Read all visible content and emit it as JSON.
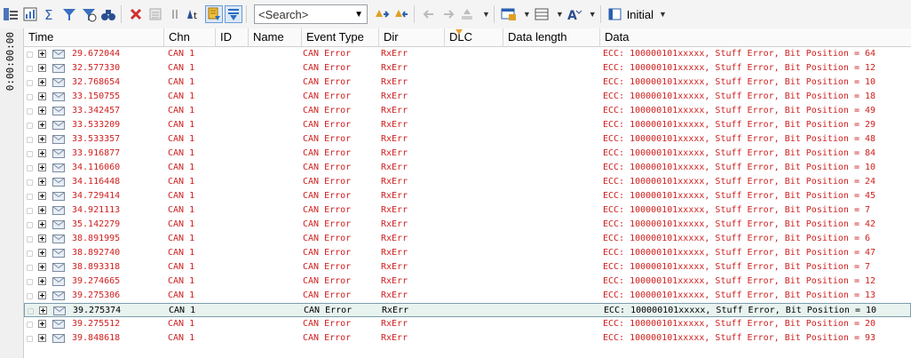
{
  "toolbar": {
    "search_placeholder": "<Search>",
    "layout_label": "Initial",
    "buttons": [
      "trace-config-icon",
      "statistics-icon",
      "filter-sigma-icon",
      "filter-funnel-icon",
      "filter-funnel-remove-icon",
      "find-binoculars-icon",
      "delete-x-icon",
      "clear-icon",
      "pause-icon",
      "auto-time-icon",
      "scroll-lock-icon",
      "chronological-icon",
      "find-next-icon",
      "find-prev-icon",
      "back-arrow-icon",
      "forward-arrow-icon",
      "marker-icon",
      "window-layout-icon",
      "columns-icon",
      "font-color-icon",
      "display-mode-icon"
    ]
  },
  "side": {
    "time_marker": "0:00:00:00"
  },
  "columns": [
    "Time",
    "Chn",
    "ID",
    "Name",
    "Event Type",
    "Dir",
    "DLC",
    "Data length",
    "Data"
  ],
  "rows": [
    {
      "time": "29.672044",
      "chn": "CAN 1",
      "event": "CAN Error",
      "dir": "RxErr",
      "data": "ECC: 100000101xxxxx, Stuff Error, Bit Position = 64"
    },
    {
      "time": "32.577330",
      "chn": "CAN 1",
      "event": "CAN Error",
      "dir": "RxErr",
      "data": "ECC: 100000101xxxxx, Stuff Error, Bit Position = 12"
    },
    {
      "time": "32.768654",
      "chn": "CAN 1",
      "event": "CAN Error",
      "dir": "RxErr",
      "data": "ECC: 100000101xxxxx, Stuff Error, Bit Position = 10"
    },
    {
      "time": "33.150755",
      "chn": "CAN 1",
      "event": "CAN Error",
      "dir": "RxErr",
      "data": "ECC: 100000101xxxxx, Stuff Error, Bit Position = 18"
    },
    {
      "time": "33.342457",
      "chn": "CAN 1",
      "event": "CAN Error",
      "dir": "RxErr",
      "data": "ECC: 100000101xxxxx, Stuff Error, Bit Position = 49"
    },
    {
      "time": "33.533209",
      "chn": "CAN 1",
      "event": "CAN Error",
      "dir": "RxErr",
      "data": "ECC: 100000101xxxxx, Stuff Error, Bit Position = 29"
    },
    {
      "time": "33.533357",
      "chn": "CAN 1",
      "event": "CAN Error",
      "dir": "RxErr",
      "data": "ECC: 100000101xxxxx, Stuff Error, Bit Position = 48"
    },
    {
      "time": "33.916877",
      "chn": "CAN 1",
      "event": "CAN Error",
      "dir": "RxErr",
      "data": "ECC: 100000101xxxxx, Stuff Error, Bit Position = 84"
    },
    {
      "time": "34.116060",
      "chn": "CAN 1",
      "event": "CAN Error",
      "dir": "RxErr",
      "data": "ECC: 100000101xxxxx, Stuff Error, Bit Position = 10"
    },
    {
      "time": "34.116448",
      "chn": "CAN 1",
      "event": "CAN Error",
      "dir": "RxErr",
      "data": "ECC: 100000101xxxxx, Stuff Error, Bit Position = 24"
    },
    {
      "time": "34.729414",
      "chn": "CAN 1",
      "event": "CAN Error",
      "dir": "RxErr",
      "data": "ECC: 100000101xxxxx, Stuff Error, Bit Position = 45"
    },
    {
      "time": "34.921113",
      "chn": "CAN 1",
      "event": "CAN Error",
      "dir": "RxErr",
      "data": "ECC: 100000101xxxxx, Stuff Error, Bit Position = 7"
    },
    {
      "time": "35.142279",
      "chn": "CAN 1",
      "event": "CAN Error",
      "dir": "RxErr",
      "data": "ECC: 100000101xxxxx, Stuff Error, Bit Position = 42"
    },
    {
      "time": "38.891995",
      "chn": "CAN 1",
      "event": "CAN Error",
      "dir": "RxErr",
      "data": "ECC: 100000101xxxxx, Stuff Error, Bit Position = 6"
    },
    {
      "time": "38.892740",
      "chn": "CAN 1",
      "event": "CAN Error",
      "dir": "RxErr",
      "data": "ECC: 100000101xxxxx, Stuff Error, Bit Position = 47"
    },
    {
      "time": "38.893318",
      "chn": "CAN 1",
      "event": "CAN Error",
      "dir": "RxErr",
      "data": "ECC: 100000101xxxxx, Stuff Error, Bit Position = 7"
    },
    {
      "time": "39.274665",
      "chn": "CAN 1",
      "event": "CAN Error",
      "dir": "RxErr",
      "data": "ECC: 100000101xxxxx, Stuff Error, Bit Position = 12"
    },
    {
      "time": "39.275306",
      "chn": "CAN 1",
      "event": "CAN Error",
      "dir": "RxErr",
      "data": "ECC: 100000101xxxxx, Stuff Error, Bit Position = 13"
    },
    {
      "time": "39.275374",
      "chn": "CAN 1",
      "event": "CAN Error",
      "dir": "RxErr",
      "data": "ECC: 100000101xxxxx, Stuff Error, Bit Position = 10"
    },
    {
      "time": "39.275512",
      "chn": "CAN 1",
      "event": "CAN Error",
      "dir": "RxErr",
      "data": "ECC: 100000101xxxxx, Stuff Error, Bit Position = 20"
    },
    {
      "time": "39.848618",
      "chn": "CAN 1",
      "event": "CAN Error",
      "dir": "RxErr",
      "data": "ECC: 100000101xxxxx, Stuff Error, Bit Position = 93"
    }
  ],
  "selected_row": 18,
  "colors": {
    "error_text": "#d02020",
    "selected_bg": "#e8f3ef",
    "selected_border": "#7c9dab"
  }
}
